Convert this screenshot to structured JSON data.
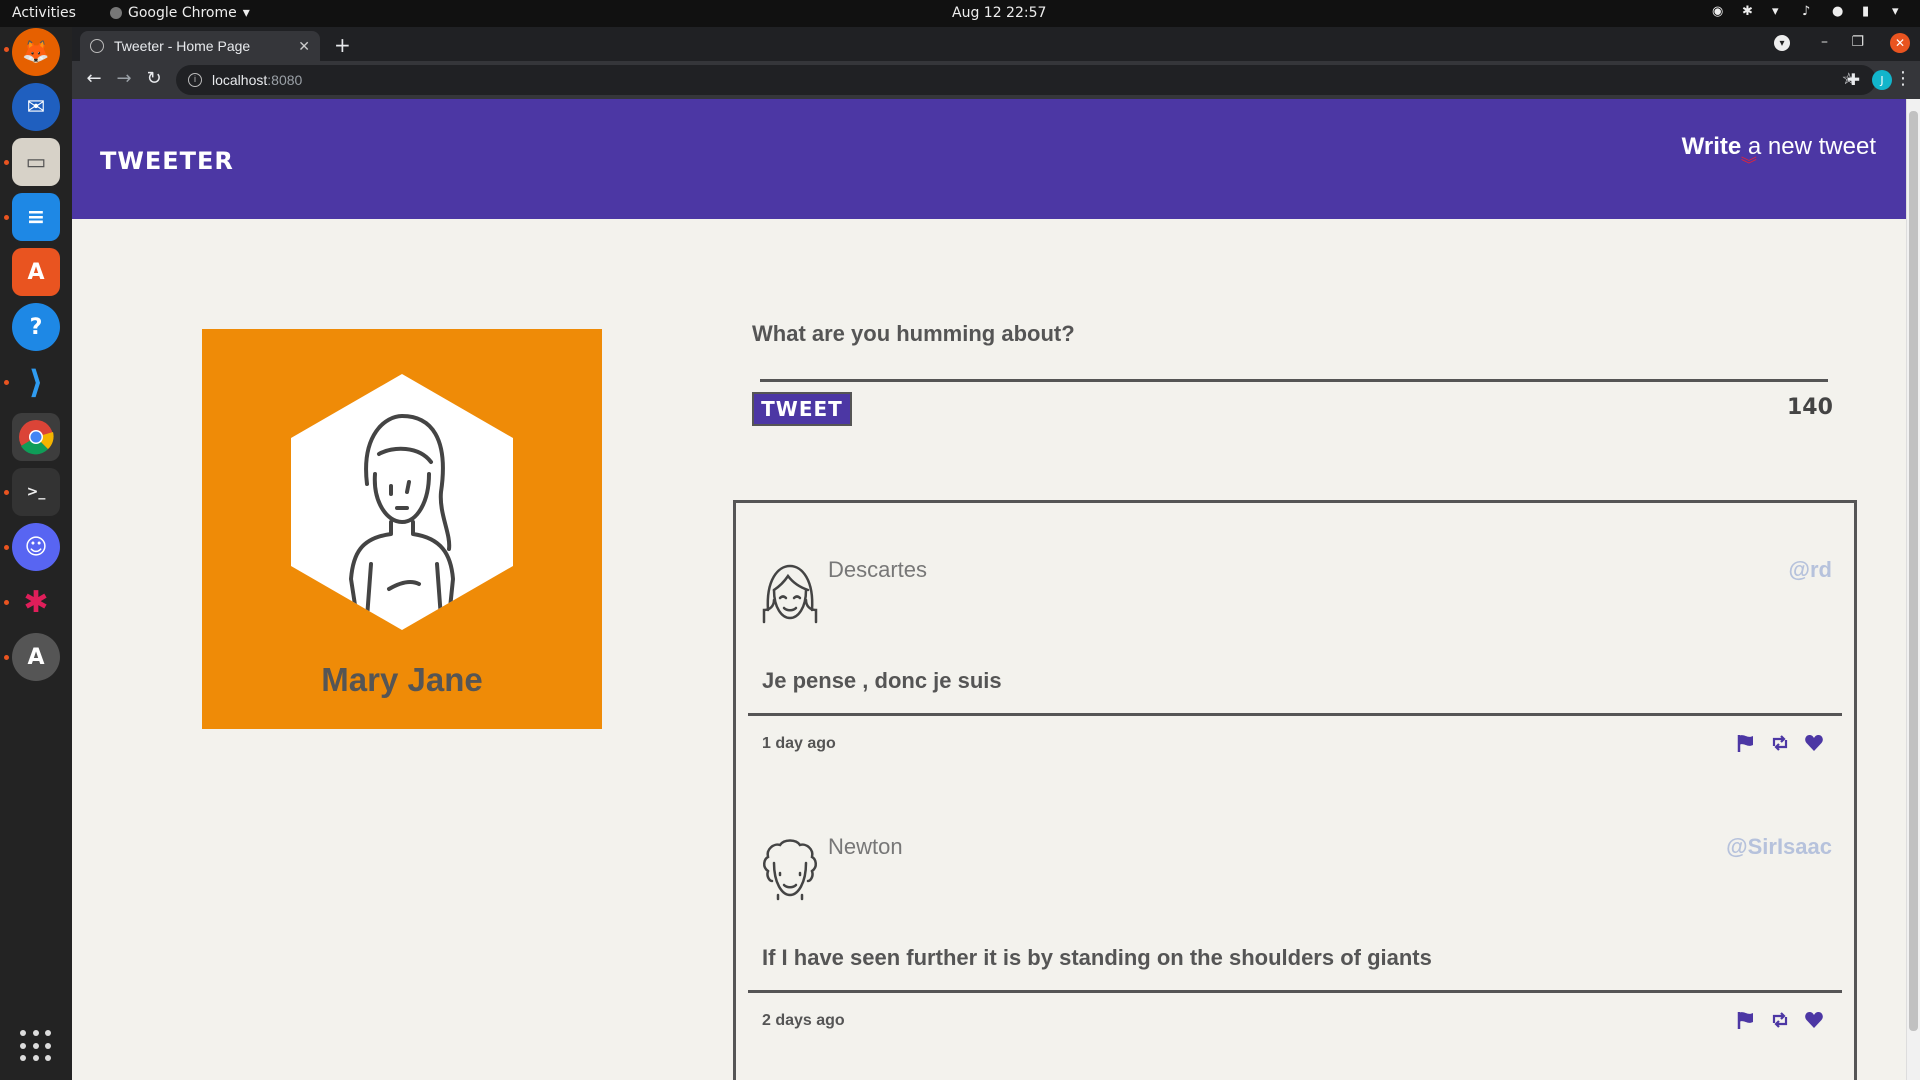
{
  "system_bar": {
    "activities": "Activities",
    "app_name": "Google Chrome",
    "clock": "Aug 12  22:57"
  },
  "dock": {
    "items": [
      "firefox-icon",
      "thunderbird-icon",
      "files-icon",
      "writer-icon",
      "app-store-icon",
      "help-icon",
      "vscode-icon",
      "chrome-icon",
      "terminal-icon",
      "discord-icon",
      "slack-icon",
      "updater-icon"
    ]
  },
  "browser": {
    "tab_title": "Tweeter - Home Page",
    "url_host": "localhost",
    "url_port": ":8080",
    "profile_initial": "J"
  },
  "site": {
    "brand": "TWEETER",
    "write_bold": "Write",
    "write_rest": " a new tweet",
    "profile_name": "Mary Jane",
    "compose_prompt": "What are you humming about?",
    "tweet_button": "TWEET",
    "char_counter": "140",
    "accent_color": "#4c37a4",
    "card_color": "#ef8b07"
  },
  "tweets": [
    {
      "name": "Descartes",
      "handle": "@rd",
      "text": "Je pense , donc je suis",
      "age": "1 day ago"
    },
    {
      "name": "Newton",
      "handle": "@SirIsaac",
      "text": "If I have seen further it is by standing on the shoulders of giants",
      "age": "2 days ago"
    }
  ]
}
